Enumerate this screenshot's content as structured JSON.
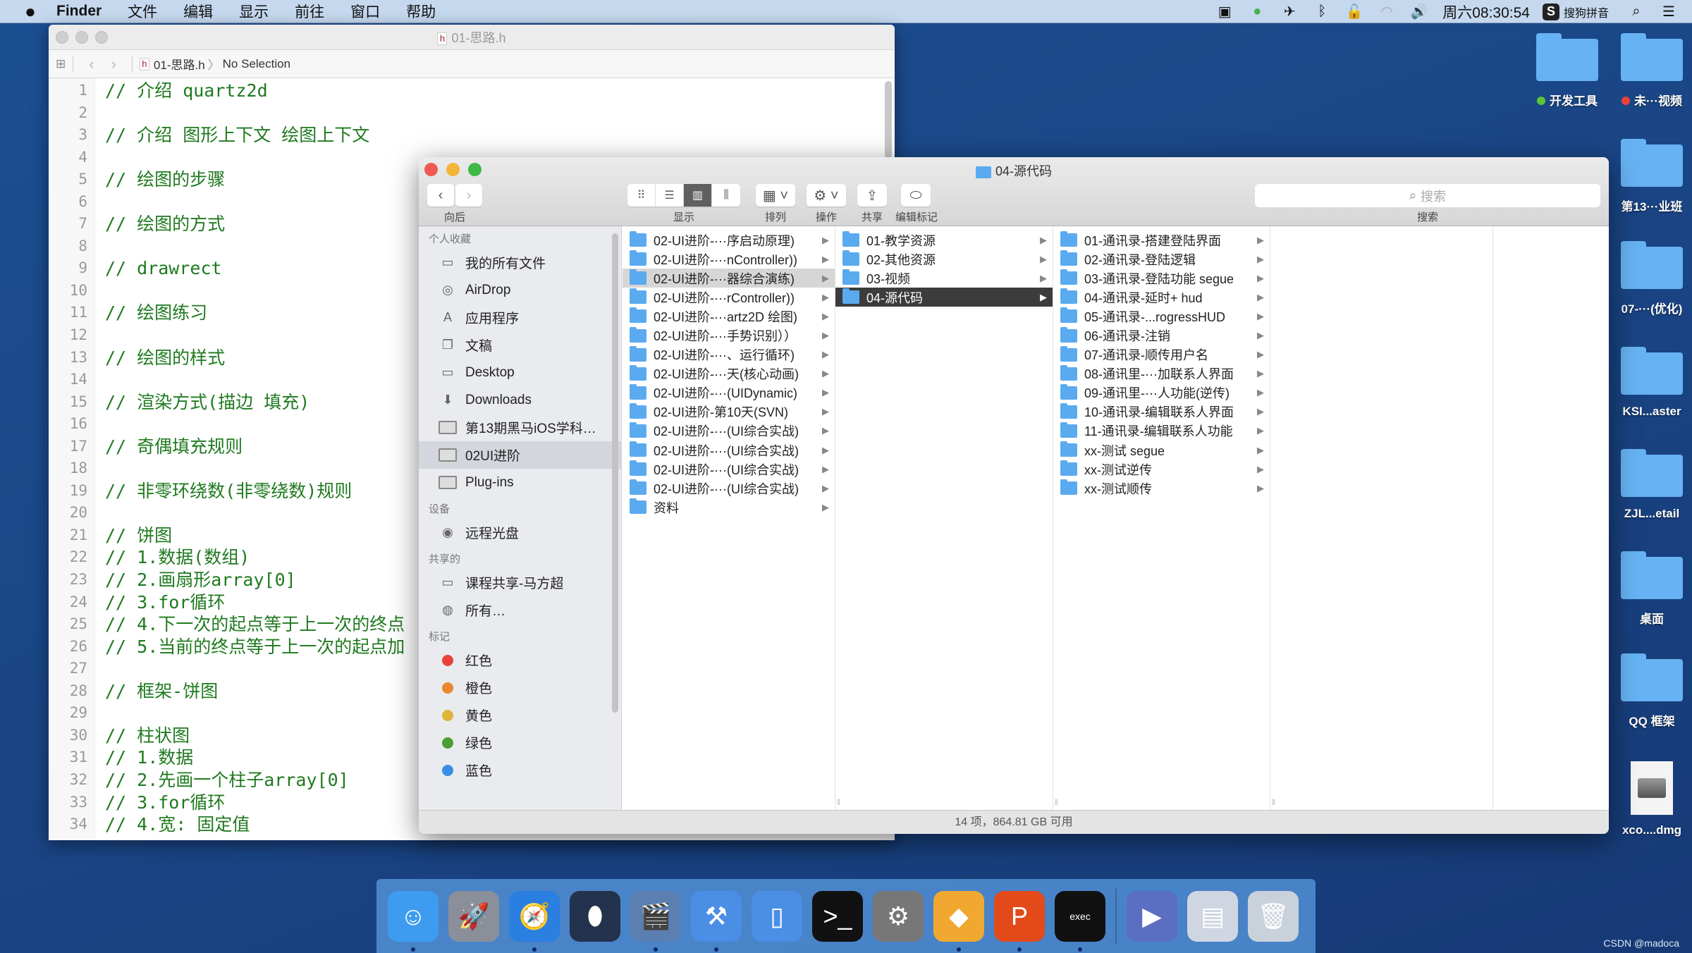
{
  "menubar": {
    "apple": "",
    "app": "Finder",
    "items": [
      "文件",
      "编辑",
      "显示",
      "前往",
      "窗口",
      "帮助"
    ],
    "status_icons": [
      "camera-record-icon",
      "play-circle-icon",
      "airplane-icon",
      "bluetooth-icon",
      "lock-icon",
      "wifi-icon",
      "volume-icon"
    ],
    "clock": "周六08:30:54",
    "ime_badge": "S",
    "ime_label": "搜狗拼音",
    "search_icon": "⌕",
    "list_icon": "☰"
  },
  "xcode": {
    "title": "01-思路.h",
    "file_badge": "h",
    "jumpbar": {
      "file": "01-思路.h",
      "selection": "No Selection"
    },
    "lines": [
      "// 介绍 quartz2d",
      "",
      "// 介绍 图形上下文 绘图上下文",
      "",
      "// 绘图的步骤",
      "",
      "// 绘图的方式",
      "",
      "// drawrect",
      "",
      "// 绘图练习",
      "",
      "// 绘图的样式",
      "",
      "// 渲染方式(描边 填充)",
      "",
      "// 奇偶填充规则",
      "",
      "// 非零环绕数(非零绕数)规则",
      "",
      "// 饼图",
      "// 1.数据(数组)",
      "// 2.画扇形array[0]",
      "// 3.for循环",
      "// 4.下一次的起点等于上一次的终点",
      "// 5.当前的终点等于上一次的起点加",
      "",
      "// 框架-饼图",
      "",
      "// 柱状图",
      "// 1.数据",
      "// 2.先画一个柱子array[0]",
      "// 3.for循环",
      "// 4.宽: 固定值"
    ]
  },
  "finder": {
    "title": "04-源代码",
    "toolbar": {
      "back_label": "向后",
      "view_label": "显示",
      "arrange_label": "排列",
      "action_label": "操作",
      "share_label": "共享",
      "tags_label": "编辑标记",
      "search_label": "搜索",
      "search_placeholder": "搜索"
    },
    "sidebar": {
      "favorites_header": "个人收藏",
      "favorites": [
        {
          "label": "我的所有文件",
          "icon": "all-files-icon",
          "glyph": "▭"
        },
        {
          "label": "AirDrop",
          "icon": "airdrop-icon",
          "glyph": "◎"
        },
        {
          "label": "应用程序",
          "icon": "applications-icon",
          "glyph": "A"
        },
        {
          "label": "文稿",
          "icon": "documents-icon",
          "glyph": "❐"
        },
        {
          "label": "Desktop",
          "icon": "desktop-icon",
          "glyph": "▭"
        },
        {
          "label": "Downloads",
          "icon": "downloads-icon",
          "glyph": "⬇"
        },
        {
          "label": "第13期黑马iOS学科…",
          "icon": "folder-icon",
          "glyph": ""
        },
        {
          "label": "02UI进阶",
          "icon": "folder-icon",
          "glyph": "",
          "selected": true
        },
        {
          "label": "Plug-ins",
          "icon": "folder-icon",
          "glyph": ""
        }
      ],
      "devices_header": "设备",
      "devices": [
        {
          "label": "远程光盘",
          "icon": "disc-icon",
          "glyph": "◉"
        }
      ],
      "shared_header": "共享的",
      "shared": [
        {
          "label": "课程共享-马方超",
          "icon": "monitor-icon",
          "glyph": "▭"
        },
        {
          "label": "所有…",
          "icon": "network-globe-icon",
          "glyph": "◍"
        }
      ],
      "tags_header": "标记",
      "tags": [
        {
          "label": "红色",
          "color": "#e8433a"
        },
        {
          "label": "橙色",
          "color": "#e8872f"
        },
        {
          "label": "黄色",
          "color": "#e0b33a"
        },
        {
          "label": "绿色",
          "color": "#4a9e34"
        },
        {
          "label": "蓝色",
          "color": "#3a8ee6"
        }
      ]
    },
    "columns": [
      {
        "items": [
          "02-UI进阶-···序启动原理)",
          "02-UI进阶-···nController))",
          "02-UI进阶-···器综合演练)",
          "02-UI进阶-···rController))",
          "02-UI进阶-···artz2D 绘图)",
          "02-UI进阶-···手势识别））",
          "02-UI进阶-···、运行循环)",
          "02-UI进阶-···天(核心动画)",
          "02-UI进阶-···(UIDynamic)",
          "02-UI进阶-第10天(SVN)",
          "02-UI进阶-···(UI综合实战)",
          "02-UI进阶-···(UI综合实战)",
          "02-UI进阶-···(UI综合实战)",
          "02-UI进阶-···(UI综合实战)",
          "资料"
        ],
        "highlighted": 2
      },
      {
        "items": [
          "01-教学资源",
          "02-其他资源",
          "03-视频",
          "04-源代码"
        ],
        "selected": 3
      },
      {
        "items": [
          "01-通讯录-搭建登陆界面",
          "02-通讯录-登陆逻辑",
          "03-通讯录-登陆功能 segue",
          "04-通讯录-延时+ hud",
          "05-通讯录-...rogressHUD",
          "06-通讯录-注销",
          "07-通讯录-顺传用户名",
          "08-通讯里-···加联系人界面",
          "09-通讯里-···人功能(逆传)",
          "10-通讯录-编辑联系人界面",
          "11-通讯录-编辑联系人功能",
          "xx-测试 segue",
          "xx-测试逆传",
          "xx-测试顺传"
        ]
      }
    ],
    "status": "14 项，864.81 GB 可用"
  },
  "desktop": {
    "icons": [
      {
        "label": "开发工具",
        "tag": "#5ac43a"
      },
      {
        "label": "未···视频",
        "tag": "#e8433a"
      },
      {
        "label": "第13···业班"
      },
      {
        "label": "07-···(优化)"
      },
      {
        "label": "KSI...aster"
      },
      {
        "label": "ZJL...etail"
      },
      {
        "label": "桌面"
      },
      {
        "label": "QQ 框架"
      },
      {
        "label": "xco....dmg",
        "type": "dmg"
      }
    ]
  },
  "dock": {
    "apps": [
      {
        "name": "finder",
        "glyph": "☺",
        "bg": "#3d9cf0",
        "running": true
      },
      {
        "name": "launchpad",
        "glyph": "🚀",
        "bg": "#8a8f99",
        "running": false
      },
      {
        "name": "safari",
        "glyph": "🧭",
        "bg": "#2a7fe0",
        "running": true
      },
      {
        "name": "mouse-app",
        "glyph": "⬮",
        "bg": "#23324d",
        "running": false
      },
      {
        "name": "screenflow",
        "glyph": "🎬",
        "bg": "#5a7fb0",
        "running": true
      },
      {
        "name": "xcode",
        "glyph": "⚒",
        "bg": "#4a8ee6",
        "running": true
      },
      {
        "name": "simulator",
        "glyph": "▯",
        "bg": "#4a8ee6",
        "running": false
      },
      {
        "name": "terminal",
        "glyph": ">_",
        "bg": "#111",
        "running": false
      },
      {
        "name": "system-preferences",
        "glyph": "⚙",
        "bg": "#777",
        "running": false
      },
      {
        "name": "sketch",
        "glyph": "◆",
        "bg": "#f0a830",
        "running": true
      },
      {
        "name": "keynote-p",
        "glyph": "P",
        "bg": "#e24a1a",
        "running": true
      },
      {
        "name": "exec",
        "glyph": "exec",
        "bg": "#111",
        "running": true
      },
      {
        "name": "media-player",
        "glyph": "▶",
        "bg": "#5b6fc2",
        "running": false
      },
      {
        "name": "preview-doc",
        "glyph": "▤",
        "bg": "#cfd6e2",
        "running": false
      },
      {
        "name": "trash",
        "glyph": "🗑",
        "bg": "#c9d1da",
        "running": false
      }
    ]
  },
  "watermark": "CSDN @madoca"
}
